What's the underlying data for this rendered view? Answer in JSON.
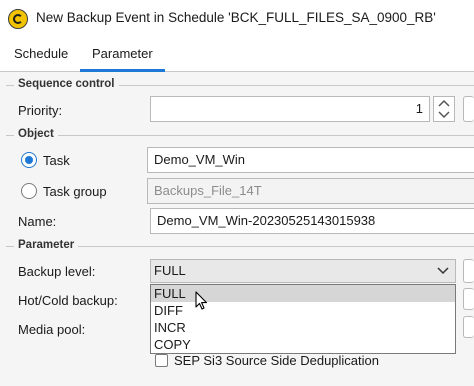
{
  "window": {
    "title": "New Backup Event in Schedule 'BCK_FULL_FILES_SA_0900_RB'",
    "app_icon": "sep-sesam-icon"
  },
  "tabs": [
    {
      "label": "Schedule",
      "active": false
    },
    {
      "label": "Parameter",
      "active": true
    }
  ],
  "sequence_control": {
    "section_title": "Sequence control",
    "priority_label": "Priority:",
    "priority_value": "1"
  },
  "object": {
    "section_title": "Object",
    "task_label": "Task",
    "task_value": "Demo_VM_Win",
    "task_group_label": "Task group",
    "task_group_value": "Backups_File_14T",
    "selected_option": "Task",
    "name_label": "Name:",
    "name_value": "Demo_VM_Win-20230525143015938"
  },
  "parameter": {
    "section_title": "Parameter",
    "backup_level_label": "Backup level:",
    "backup_level_value": "FULL",
    "backup_level_options": [
      "FULL",
      "DIFF",
      "INCR",
      "COPY"
    ],
    "hot_cold_label": "Hot/Cold backup:",
    "media_pool_label": "Media pool:",
    "dedup_label": "SEP Si3 Source Side Deduplication"
  },
  "colors": {
    "accent": "#1d78d6",
    "content_bg": "#f5f5f5"
  }
}
